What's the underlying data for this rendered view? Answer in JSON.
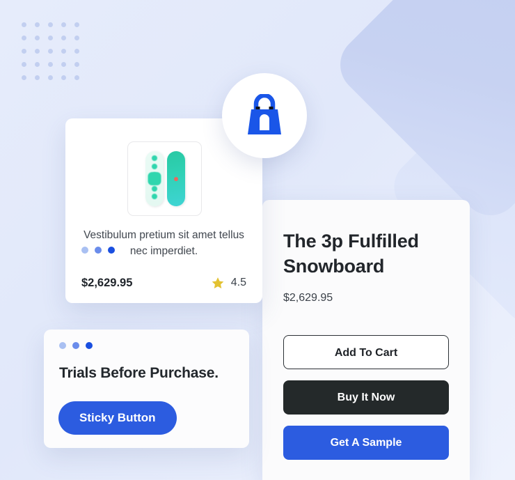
{
  "theme": {
    "background_start": "#e6ecfb",
    "background_end": "#eef2fd",
    "decor_shape": "#c7d2f2",
    "accent_blue": "#2c5ce0",
    "dark_button": "#24292a",
    "star_yellow": "#e3c232",
    "board_teal": "#2fd1b4"
  },
  "decor": {
    "dot_grid_label": "dot-grid-pattern",
    "dot_count": 25,
    "diamond_label": "rotated-rounded-square"
  },
  "bag_badge": {
    "icon": "shopping-bag-icon"
  },
  "product_card": {
    "window_dots": [
      "light-blue",
      "medium-blue",
      "strong-blue"
    ],
    "thumbnail_alt": "snowboard-pair-thumbnail",
    "description": "Vestibulum pretium sit amet tellus nec imperdiet.",
    "price": "$2,629.95",
    "rating_icon": "star-icon",
    "rating_value": "4.5"
  },
  "sticky_card": {
    "window_dots": [
      "light-blue",
      "medium-blue",
      "strong-blue"
    ],
    "title": "Trials Before Purchase.",
    "button_label": "Sticky Button"
  },
  "detail_panel": {
    "title": "The 3p Fulfilled Snowboard",
    "price": "$2,629.95",
    "buttons": [
      {
        "label": "Add To Cart",
        "style": "outline"
      },
      {
        "label": "Buy It Now",
        "style": "dark"
      },
      {
        "label": "Get A Sample",
        "style": "blue"
      }
    ]
  }
}
